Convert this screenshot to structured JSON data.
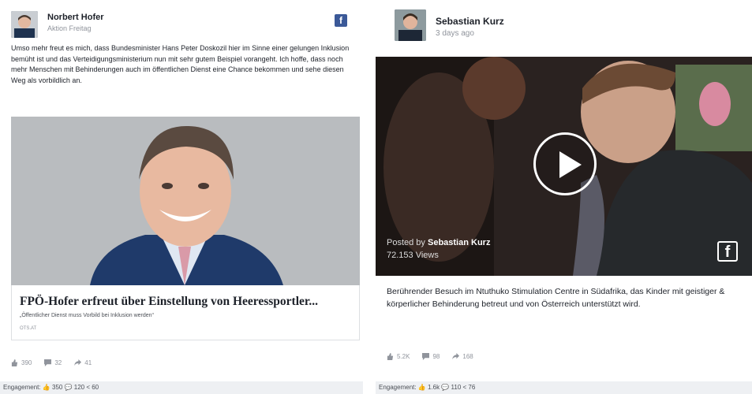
{
  "left_post": {
    "author": "Norbert Hofer",
    "subtitle": "Aktion Freitag",
    "fb_glyph": "f",
    "body": "Umso mehr freut es mich, dass Bundesminister Hans Peter Doskozil hier im Sinne einer gelungen Inklusion bemüht ist und das Verteidigungsministerium nun mit sehr gutem Beispiel vorangeht. Ich hoffe, dass noch mehr Menschen mit Behinderungen auch im öffentlichen Dienst eine Chance bekommen und sehe diesen Weg als vorbildlich an.",
    "link_title": "FPÖ-Hofer erfreut über Einstellung von Heeressportler...",
    "link_desc": "„Öffentlicher Dienst muss Vorbild bei Inklusion werden“",
    "link_domain": "OTS.AT",
    "likes": "390",
    "comments": "32",
    "shares": "41",
    "engagement": "Engagement: 👍 350 💬 120 < 60"
  },
  "right_post": {
    "author": "Sebastian Kurz",
    "subtitle": "3 days ago",
    "posted_prefix": "Posted by",
    "posted_name": "Sebastian Kurz",
    "views": "72.153 Views",
    "fb_glyph": "f",
    "caption": "Berührender Besuch im Ntuthuko Stimulation Centre in Südafrika, das Kinder mit geistiger & körperlicher Behinderung betreut und von Österreich unterstützt wird.",
    "likes": "5.2K",
    "comments": "98",
    "shares": "168",
    "engagement": "Engagement: 👍 1.6k 💬 110 < 76"
  },
  "colors": {
    "facebook_blue": "#3b5998",
    "engagement_bar": "#eef0f3"
  },
  "icons": [
    "facebook-icon",
    "play-icon",
    "like-icon",
    "comment-icon",
    "share-icon"
  ]
}
